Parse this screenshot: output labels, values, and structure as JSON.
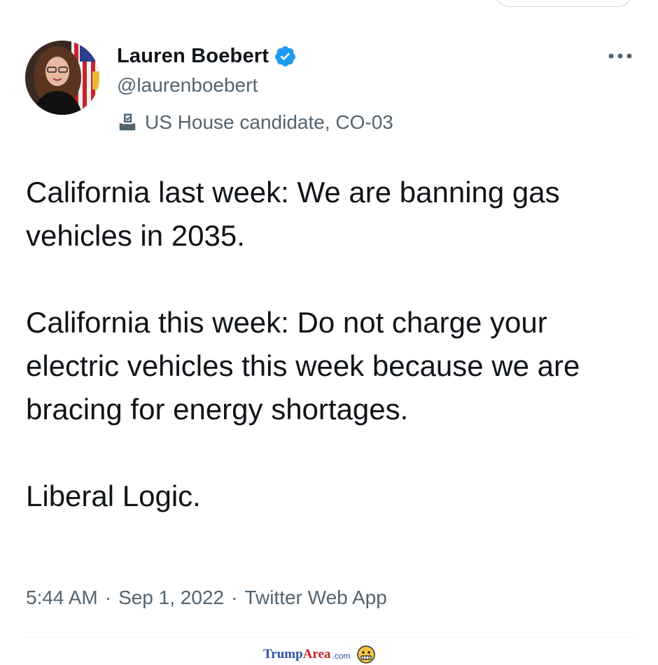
{
  "profile": {
    "name": "Lauren Boebert",
    "handle": "@laurenboebert",
    "label": "US House candidate, CO-03",
    "label_icon": "ballot-box-icon",
    "verified_icon": "verified-badge-icon"
  },
  "tweet": {
    "paragraphs": [
      "California last week: We are banning gas vehicles in 2035.",
      "California this week: Do not charge your electric vehicles this week because we are bracing for energy shortages.",
      "Liberal Logic."
    ],
    "time": "5:44 AM",
    "date": "Sep 1, 2022",
    "source": "Twitter Web App",
    "separator": "·"
  },
  "watermark": {
    "part1": "Trump",
    "part2": "Area",
    "suffix": ".com"
  },
  "colors": {
    "verified_blue": "#1d9bf0",
    "secondary_text": "#536471",
    "primary_text": "#0f1419"
  }
}
